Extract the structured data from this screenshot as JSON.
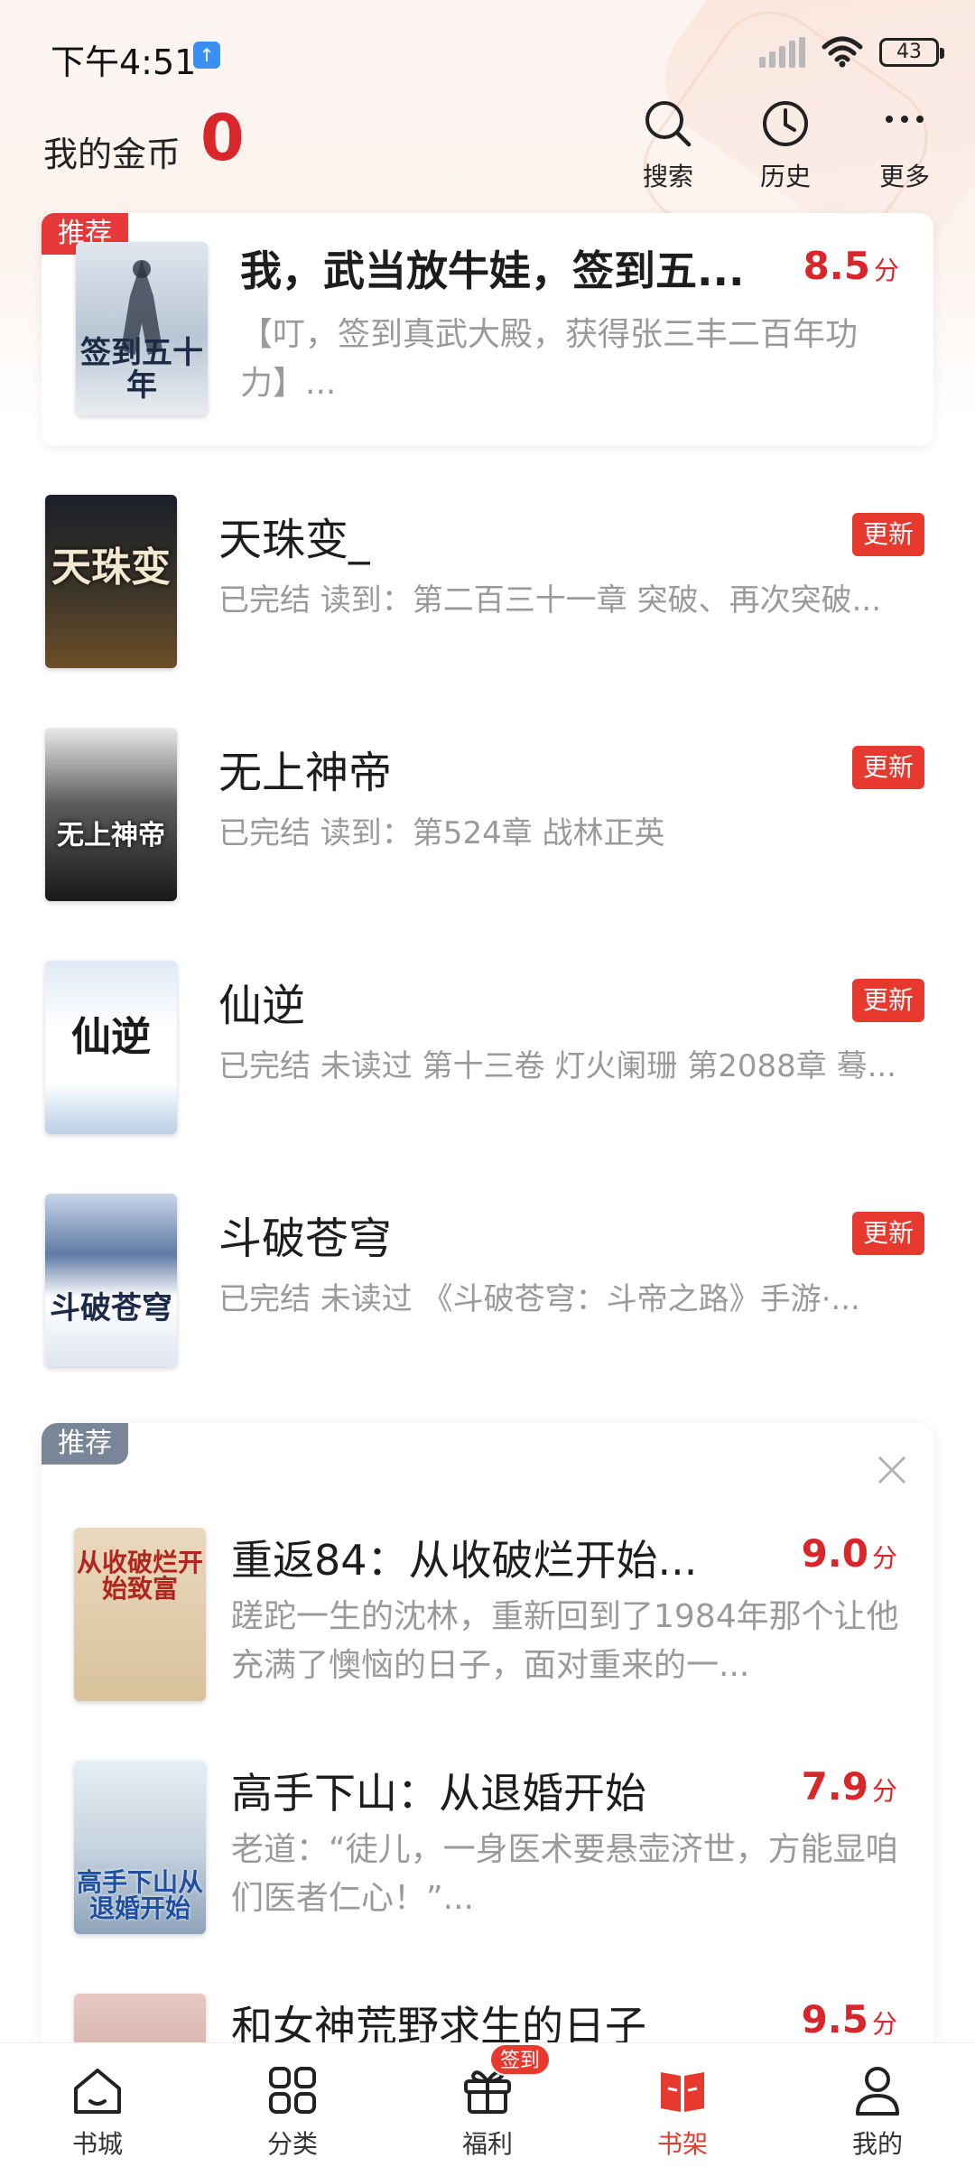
{
  "status_bar": {
    "time": "下午4:51",
    "notification_badge": "↑",
    "battery": "43"
  },
  "header": {
    "coins_label": "我的金币",
    "coins_value": "0",
    "buttons": [
      {
        "label": "搜索",
        "icon": "search-icon"
      },
      {
        "label": "历史",
        "icon": "clock-icon"
      },
      {
        "label": "更多",
        "icon": "more-icon"
      }
    ]
  },
  "featured": {
    "tag": "推荐",
    "title": "我，武当放牛娃，签到五...",
    "desc": "【叮，签到真武大殿，获得张三丰二百年功力】...",
    "score": "8.5",
    "score_unit": "分",
    "cover_text": "签到五十年"
  },
  "shelf": [
    {
      "title": "天珠变_",
      "desc": "已完结 读到：第二百三十一章 突破、再次突破...",
      "badge": "更新",
      "cover_text": "天珠变"
    },
    {
      "title": "无上神帝",
      "desc": "已完结 读到：第524章  战林正英",
      "badge": "更新",
      "cover_text": "无上神帝"
    },
    {
      "title": "仙逆",
      "desc": "已完结 未读过 第十三卷 灯火阑珊 第2088章 蓦...",
      "badge": "更新",
      "cover_text": "仙逆"
    },
    {
      "title": "斗破苍穹",
      "desc": "已完结 未读过 《斗破苍穹：斗帝之路》手游·...",
      "badge": "更新",
      "cover_text": "斗破苍穹"
    }
  ],
  "recommend": {
    "tag": "推荐",
    "items": [
      {
        "title": "重返84：从收破烂开始...",
        "desc": "蹉跎一生的沈林，重新回到了1984年那个让他充满了懊恼的日子，面对重来的一...",
        "score": "9.0",
        "score_unit": "分",
        "cover_text": "从收破烂开始致富"
      },
      {
        "title": "高手下山：从退婚开始",
        "desc": "老道：“徒儿，一身医术要悬壶济世，方能显咱们医者仁心！”...",
        "score": "7.9",
        "score_unit": "分",
        "cover_text": "高手下山从退婚开始"
      },
      {
        "title": "和女神荒野求生的日子",
        "desc": "",
        "score": "9.5",
        "score_unit": "分",
        "cover_text": ""
      }
    ]
  },
  "bottom_nav": [
    {
      "label": "书城",
      "icon": "home-icon"
    },
    {
      "label": "分类",
      "icon": "grid-icon"
    },
    {
      "label": "福利",
      "icon": "gift-icon",
      "badge": "签到"
    },
    {
      "label": "书架",
      "icon": "bookshelf-icon",
      "active": true
    },
    {
      "label": "我的",
      "icon": "user-icon"
    }
  ],
  "colors": {
    "accent": "#d9262b",
    "badge": "#e8392e",
    "muted_text": "#9a9a9a",
    "recommend_tag_grey": "#7a8698"
  }
}
